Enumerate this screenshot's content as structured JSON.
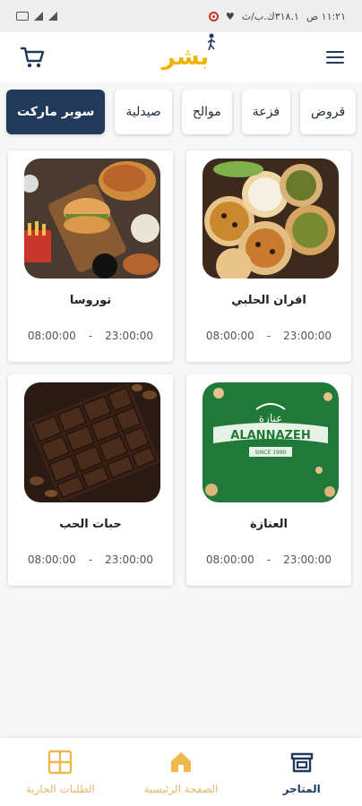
{
  "status_bar": {
    "time": "١١:٢١ ص",
    "network": "٣١٨.١ك.ب/ث"
  },
  "header": {
    "logo_text": "بشر",
    "cart_icon": "cart-icon",
    "menu_icon": "menu-icon",
    "brand_color": "#f0b400",
    "navy": "#213a5c"
  },
  "categories": [
    {
      "label": "سوبر ماركت",
      "active": true
    },
    {
      "label": "صيدلية",
      "active": false
    },
    {
      "label": "موالح",
      "active": false
    },
    {
      "label": "فزعة",
      "active": false
    },
    {
      "label": "قروض",
      "active": false
    }
  ],
  "stores": [
    {
      "name": "افران الحلبي",
      "open": "08:00:00",
      "close": "23:00:00",
      "image": "manakish-image"
    },
    {
      "name": "توروسا",
      "open": "08:00:00",
      "close": "23:00:00",
      "image": "fastfood-image"
    },
    {
      "name": "العنازة",
      "open": "08:00:00",
      "close": "23:00:00",
      "image": "alannazeh-logo-image",
      "logo_text": "ALANNAZEH",
      "logo_sub": "SINCE 1980"
    },
    {
      "name": "حبات الحب",
      "open": "08:00:00",
      "close": "23:00:00",
      "image": "chocolate-image"
    }
  ],
  "bottom_nav": [
    {
      "label": "المتاجر",
      "icon": "store-icon",
      "active": true
    },
    {
      "label": "الصفحة الرئيسية",
      "icon": "home-icon",
      "active": false
    },
    {
      "label": "الطلبات الجارية",
      "icon": "orders-grid-icon",
      "active": false
    }
  ]
}
